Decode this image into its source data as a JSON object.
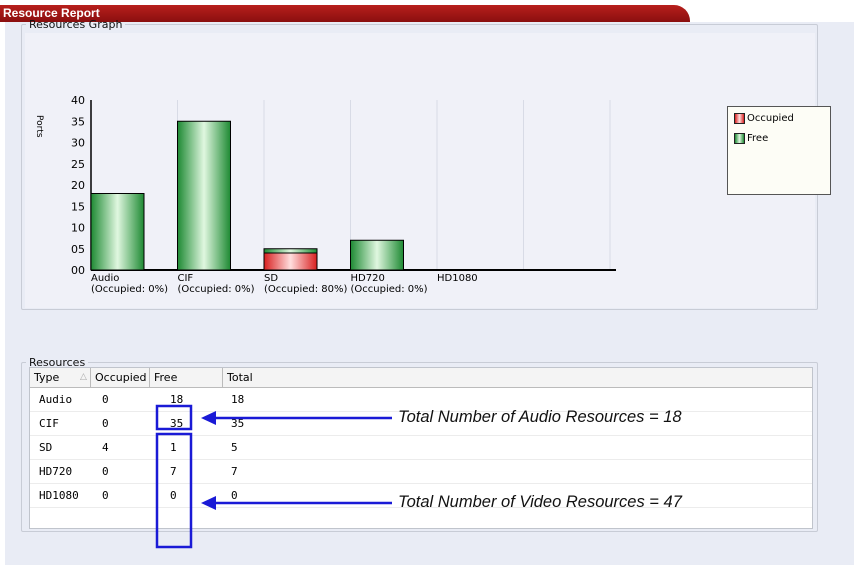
{
  "window": {
    "title": "Resource Report",
    "close": "×"
  },
  "graph": {
    "legend_label": "Resources Graph"
  },
  "chart_data": {
    "type": "bar",
    "stacked": true,
    "ylabel": "Ports",
    "ylim": [
      0,
      40
    ],
    "yticks": [
      "00",
      "05",
      "10",
      "15",
      "20",
      "25",
      "30",
      "35",
      "40"
    ],
    "categories": [
      "Audio",
      "CIF",
      "SD",
      "HD720",
      "HD1080"
    ],
    "category_sublabels": [
      "(Occupied: 0%)",
      "(Occupied: 0%)",
      "(Occupied: 80%)",
      "(Occupied: 0%)",
      ""
    ],
    "series": [
      {
        "name": "Occupied",
        "values": [
          0,
          0,
          4,
          0,
          0
        ],
        "color": "#e43a3a"
      },
      {
        "name": "Free",
        "values": [
          18,
          35,
          1,
          7,
          0
        ],
        "color": "#2f9a3e"
      }
    ],
    "legend": "right",
    "grid": true
  },
  "resources": {
    "legend_label": "Resources",
    "columns": [
      "Type",
      "Occupied",
      "Free",
      "Total"
    ],
    "sort_indicator": "△",
    "rows": [
      [
        "Audio",
        "0",
        "18",
        "18"
      ],
      [
        "CIF",
        "0",
        "35",
        "35"
      ],
      [
        "SD",
        "4",
        "1",
        "5"
      ],
      [
        "HD720",
        "0",
        "7",
        "7"
      ],
      [
        "HD1080",
        "0",
        "0",
        "0"
      ]
    ]
  },
  "annotations": {
    "audio": "Total Number of Audio Resources = 18",
    "video": "Total Number of Video Resources = 47",
    "color": "#1a1ad6"
  }
}
